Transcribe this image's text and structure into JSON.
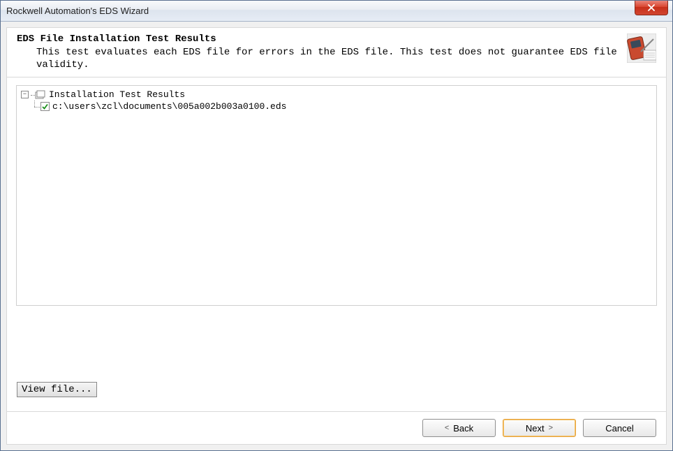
{
  "window": {
    "title": "Rockwell Automation's EDS Wizard"
  },
  "header": {
    "title": "EDS File Installation Test Results",
    "description": "This test evaluates each EDS file for errors in the EDS file. This test does not guarantee EDS file validity."
  },
  "tree": {
    "root_label": "Installation Test Results",
    "items": [
      {
        "path": "c:\\users\\zcl\\documents\\005a002b003a0100.eds",
        "status": "ok"
      }
    ]
  },
  "buttons": {
    "view_file": "View file...",
    "back": "Back",
    "next": "Next",
    "cancel": "Cancel"
  },
  "glyphs": {
    "chevron_left": "<",
    "chevron_right": ">",
    "minus": "−"
  }
}
